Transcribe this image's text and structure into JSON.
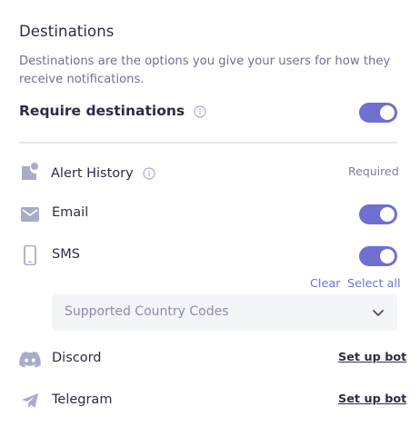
{
  "section": {
    "title": "Destinations",
    "description": "Destinations are the options you give your users for how they receive notifications."
  },
  "require": {
    "label": "Require destinations",
    "enabled": true
  },
  "destinations": [
    {
      "name": "Alert History",
      "icon": "alert-history-icon",
      "status": "Required"
    },
    {
      "name": "Email",
      "icon": "email-icon",
      "enabled": true
    },
    {
      "name": "SMS",
      "icon": "phone-icon",
      "enabled": true
    },
    {
      "name": "Discord",
      "icon": "discord-icon",
      "action": "Set up bot"
    },
    {
      "name": "Telegram",
      "icon": "telegram-icon",
      "action": "Set up bot"
    }
  ],
  "sms_options": {
    "clear_label": "Clear",
    "select_all_label": "Select all",
    "country_codes_placeholder": "Supported Country Codes"
  },
  "colors": {
    "accent": "#6f6fd1",
    "icon": "#a9abc9",
    "text": "#2b2d42",
    "muted": "#6e7290"
  }
}
